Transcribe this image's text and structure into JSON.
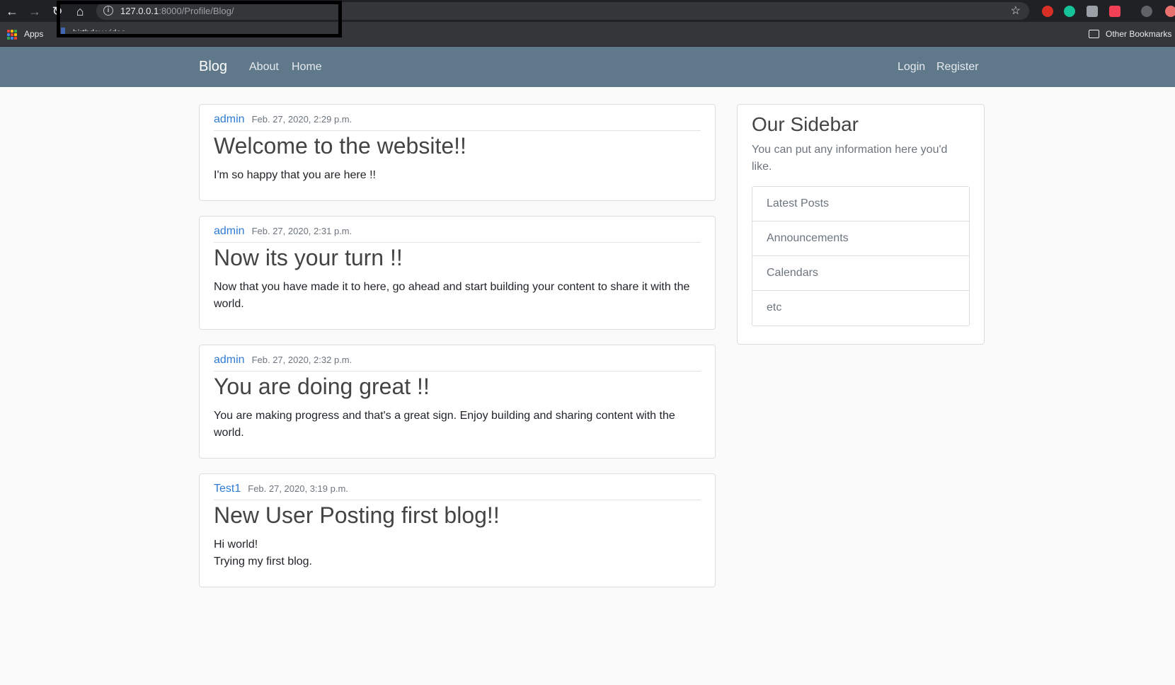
{
  "browser": {
    "url_host": "127.0.0.1",
    "url_path": ":8000/Profile/Blog/",
    "bookmarks": {
      "apps": "Apps",
      "birthday": "birthday video",
      "other": "Other Bookmarks"
    }
  },
  "navbar": {
    "brand": "Blog",
    "links": [
      "About",
      "Home"
    ],
    "auth": [
      "Login",
      "Register"
    ]
  },
  "posts": [
    {
      "author": "admin",
      "date": "Feb. 27, 2020, 2:29 p.m.",
      "title": "Welcome to the website!!",
      "body": [
        "I'm so happy that you are here !!"
      ]
    },
    {
      "author": "admin",
      "date": "Feb. 27, 2020, 2:31 p.m.",
      "title": "Now its your turn !!",
      "body": [
        "Now that you have made it to here, go ahead and start building your content to share it with the world."
      ]
    },
    {
      "author": "admin",
      "date": "Feb. 27, 2020, 2:32 p.m.",
      "title": "You are doing great !!",
      "body": [
        "You are making progress and that's a great sign. Enjoy building and sharing content with the world."
      ]
    },
    {
      "author": "Test1",
      "date": "Feb. 27, 2020, 3:19 p.m.",
      "title": "New User Posting first blog!!",
      "body": [
        "Hi world!",
        "Trying my first blog."
      ]
    }
  ],
  "sidebar": {
    "title": "Our Sidebar",
    "subtitle": "You can put any information here you'd like.",
    "items": [
      "Latest Posts",
      "Announcements",
      "Calendars",
      "etc"
    ]
  }
}
